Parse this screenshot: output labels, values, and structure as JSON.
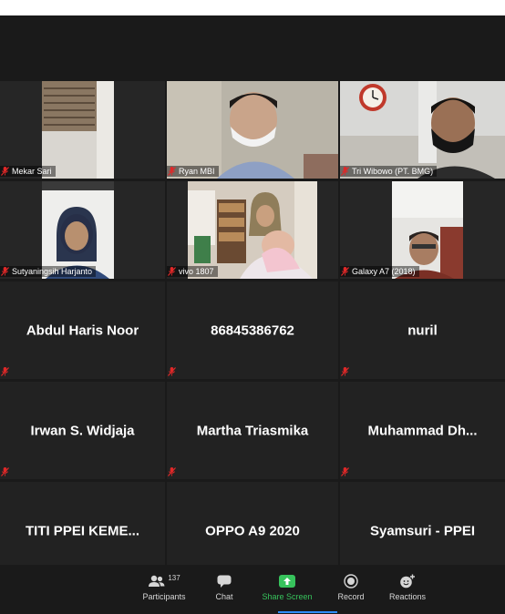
{
  "tiles_video": [
    {
      "name": "Mekar Sari"
    },
    {
      "name": "Ryan MBI"
    },
    {
      "name": "Tri Wibowo (PT. BMG)"
    },
    {
      "name": "Sutyaningsih Harjanto"
    },
    {
      "name": "vivo 1807"
    },
    {
      "name": "Galaxy A7 (2018)"
    }
  ],
  "tiles_name": [
    {
      "name": "Abdul Haris Noor"
    },
    {
      "name": "86845386762"
    },
    {
      "name": "nuril"
    },
    {
      "name": "Irwan S. Widjaja"
    },
    {
      "name": "Martha Triasmika"
    },
    {
      "name": "Muhammad  Dh..."
    },
    {
      "name": "TITI  PPEI  KEME..."
    },
    {
      "name": "OPPO A9 2020"
    },
    {
      "name": "Syamsuri - PPEI"
    }
  ],
  "toolbar": {
    "participants_label": "Participants",
    "participants_count": "137",
    "chat_label": "Chat",
    "share_label": "Share Screen",
    "record_label": "Record",
    "reactions_label": "Reactions"
  },
  "colors": {
    "background": "#1a1a1a",
    "tile": "#262626",
    "share_green": "#37c35c",
    "mute_red": "#e02828"
  },
  "icons": {
    "mute": "microphone-muted-icon",
    "participants": "participants-icon",
    "chat": "chat-icon",
    "share": "share-screen-icon",
    "record": "record-icon",
    "reactions": "reactions-icon"
  }
}
